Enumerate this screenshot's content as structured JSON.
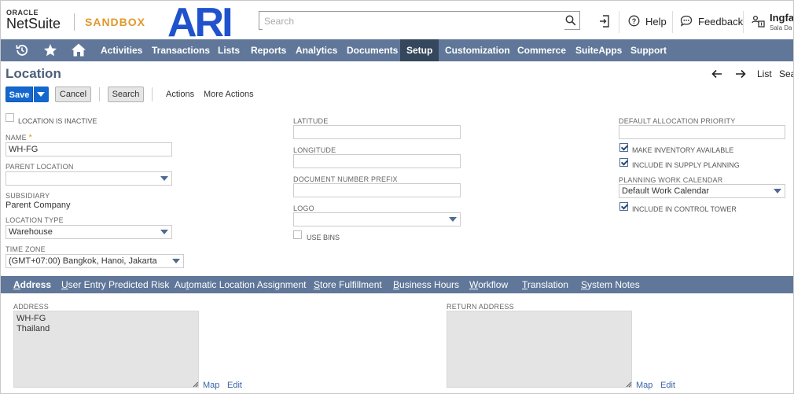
{
  "header": {
    "oracle_label": "ORACLE",
    "netsuite_label": "NetSuite",
    "sandbox_label": "SANDBOX",
    "brand_logo_text": "ARI",
    "search_placeholder": "Search",
    "help_label": "Help",
    "feedback_label": "Feedback",
    "user_name": "Ingfa",
    "user_sub": "Sala Da"
  },
  "nav": {
    "items": [
      "Activities",
      "Transactions",
      "Lists",
      "Reports",
      "Analytics",
      "Documents",
      "Setup",
      "Customization",
      "Commerce",
      "SuiteApps",
      "Support"
    ],
    "active": "Setup",
    "icons": [
      "recent-icon",
      "star-icon",
      "home-icon"
    ]
  },
  "page": {
    "title": "Location",
    "list_label": "List",
    "search_label": "Sea"
  },
  "toolbar": {
    "save": "Save",
    "cancel": "Cancel",
    "search": "Search",
    "actions": "Actions",
    "more_actions": "More Actions"
  },
  "form": {
    "location_inactive_label": "LOCATION IS INACTIVE",
    "location_inactive": false,
    "name_label": "NAME",
    "name_value": "WH-FG",
    "parent_location_label": "PARENT LOCATION",
    "parent_location_value": "",
    "subsidiary_label": "SUBSIDIARY",
    "subsidiary_value": "Parent Company",
    "location_type_label": "LOCATION TYPE",
    "location_type_value": "Warehouse",
    "time_zone_label": "TIME ZONE",
    "time_zone_value": "(GMT+07:00) Bangkok, Hanoi, Jakarta",
    "latitude_label": "LATITUDE",
    "latitude_value": "",
    "longitude_label": "LONGITUDE",
    "longitude_value": "",
    "doc_prefix_label": "DOCUMENT NUMBER PREFIX",
    "doc_prefix_value": "",
    "logo_label": "LOGO",
    "logo_value": "",
    "use_bins_label": "USE BINS",
    "use_bins": false,
    "default_alloc_label": "DEFAULT ALLOCATION PRIORITY",
    "default_alloc_value": "",
    "make_inventory_label": "MAKE INVENTORY AVAILABLE",
    "make_inventory": true,
    "include_supply_label": "INCLUDE IN SUPPLY PLANNING",
    "include_supply": true,
    "planning_calendar_label": "PLANNING WORK CALENDAR",
    "planning_calendar_value": "Default Work Calendar",
    "include_control_label": "INCLUDE IN CONTROL TOWER",
    "include_control": true
  },
  "subtabs": {
    "items": [
      "Address",
      "User Entry Predicted Risk",
      "Automatic Location Assignment",
      "Store Fulfillment",
      "Business Hours",
      "Workflow",
      "Translation",
      "System Notes"
    ],
    "active": "Address"
  },
  "address": {
    "address_label": "ADDRESS",
    "address_line1": "WH-FG",
    "address_line2": "Thailand",
    "return_address_label": "RETURN ADDRESS",
    "map_label": "Map",
    "edit_label": "Edit"
  },
  "colors": {
    "nav_bg": "#607799",
    "nav_active": "#35475c",
    "save_blue": "#1467cc",
    "sandbox_orange": "#e0982b",
    "brand_blue": "#1f52cc"
  }
}
